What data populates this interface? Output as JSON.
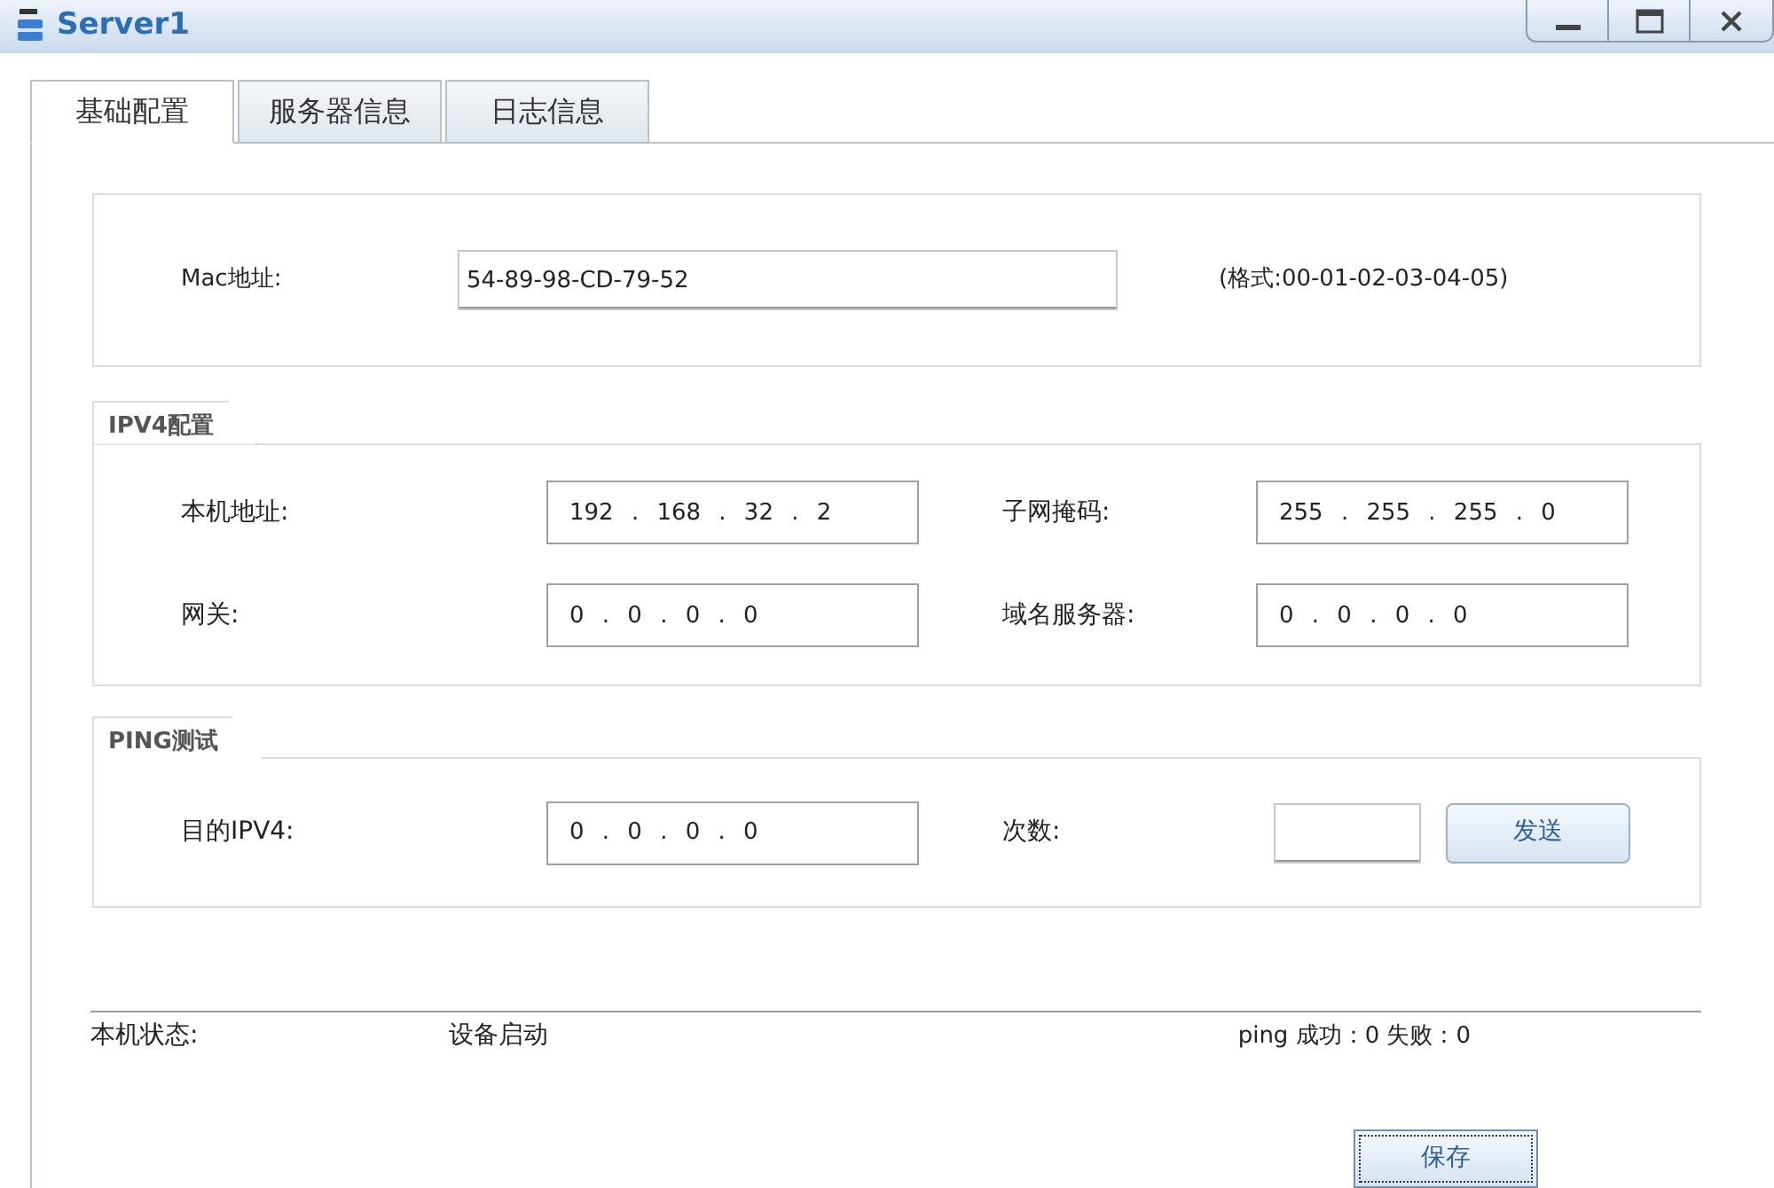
{
  "window": {
    "title": "Server1"
  },
  "tabs": [
    {
      "label": "基础配置",
      "selected": true
    },
    {
      "label": "服务器信息",
      "selected": false
    },
    {
      "label": "日志信息",
      "selected": false
    }
  ],
  "mac": {
    "label": "Mac地址:",
    "value": "54-89-98-CD-79-52",
    "hint": "(格式:00-01-02-03-04-05)"
  },
  "ipv4": {
    "title": "IPV4配置",
    "fields": [
      {
        "label": "本机地址:",
        "value": "192 . 168 . 32 . 2"
      },
      {
        "label": "子网掩码:",
        "value": "255 . 255 . 255 . 0"
      },
      {
        "label": "网关:",
        "value": "0 . 0 . 0 . 0"
      },
      {
        "label": "域名服务器:",
        "value": "0 . 0 . 0 . 0"
      }
    ]
  },
  "ping": {
    "title": "PING测试",
    "target": {
      "label": "目的IPV4:",
      "value": "0 . 0 . 0 . 0"
    },
    "count": {
      "label": "次数:"
    },
    "send_button": "发送"
  },
  "status": {
    "label": "本机状态:",
    "value": "设备启动",
    "stats": "ping 成功：0 失败：0"
  },
  "save_button": "保存"
}
